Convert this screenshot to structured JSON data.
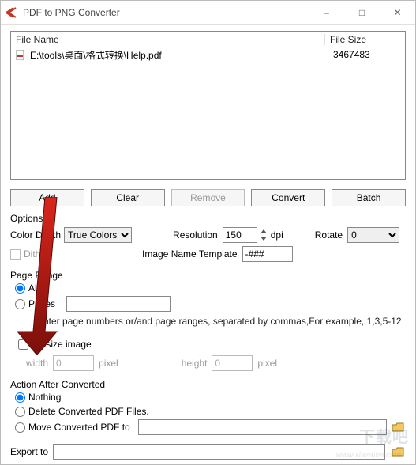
{
  "window": {
    "title": "PDF to PNG Converter",
    "min": "–",
    "max": "□",
    "close": "✕"
  },
  "list": {
    "col_name": "File Name",
    "col_size": "File Size",
    "rows": [
      {
        "name": "E:\\tools\\桌面\\格式转换\\Help.pdf",
        "size": "3467483"
      }
    ]
  },
  "buttons": {
    "add": "Add",
    "clear": "Clear",
    "remove": "Remove",
    "convert": "Convert",
    "batch": "Batch"
  },
  "options": {
    "title": "Options",
    "color_depth_label": "Color Depth",
    "color_depth_value": "True Colors",
    "dither_label": "Dither",
    "resolution_label": "Resolution",
    "resolution_value": "150",
    "resolution_unit": "dpi",
    "rotate_label": "Rotate",
    "rotate_value": "0",
    "template_label": "Image Name Template",
    "template_value": "-###"
  },
  "page_range": {
    "title": "Page Range",
    "all": "All",
    "pages": "Pages",
    "pages_value": "",
    "hint": "Enter page numbers or/and page ranges, separated by commas,For example, 1,3,5-12"
  },
  "resize": {
    "label": "Resize image",
    "width_label": "width",
    "width_value": "0",
    "height_label": "height",
    "height_value": "0",
    "unit": "pixel"
  },
  "action": {
    "title": "Action After Converted",
    "nothing": "Nothing",
    "delete": "Delete Converted PDF Files.",
    "move": "Move Converted PDF to",
    "move_path": ""
  },
  "export": {
    "label": "Export to",
    "value": ""
  },
  "watermark": {
    "big": "下载吧",
    "small": "www.xiazaiba.com"
  }
}
